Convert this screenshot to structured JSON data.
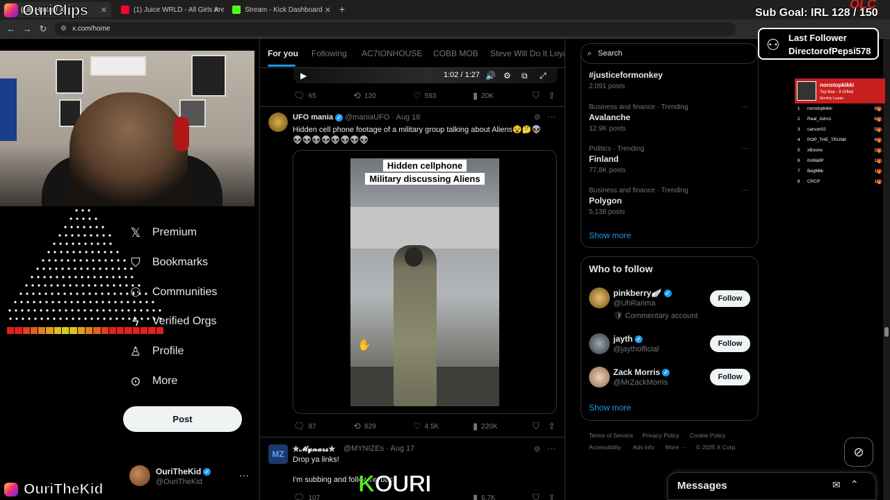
{
  "browser": {
    "tabs": [
      {
        "title": "(18) Home / X",
        "color": "#e0245e"
      },
      {
        "title": "(1) Juice WRLD - All Girls Are Th",
        "color": "#ff0033"
      },
      {
        "title": "Stream - Kick Dashboard",
        "color": "#53fc18"
      }
    ],
    "new_tab": "+",
    "url": "x.com/home"
  },
  "overlay": {
    "brand": "OuriClips",
    "sub_goal": "Sub Goal: IRL  128 / 150",
    "olc": "OLC",
    "last_follower_label": "Last Follower",
    "last_follower_name": "DirectorofPepsi578",
    "streamer": "OuriTheKid",
    "kick_logo": "K",
    "kick_text": "OURI",
    "leaderboard": {
      "top_name": "nonstopkikki",
      "top_sub": "Top Bae - 9 Gifted",
      "top_sub2": "Monthly Leader",
      "rows": [
        {
          "rank": "1",
          "user": "nonstopkikki",
          "count": "9"
        },
        {
          "rank": "2",
          "user": "Real_John1",
          "count": "6"
        },
        {
          "rank": "3",
          "user": "carson02",
          "count": "5"
        },
        {
          "rank": "4",
          "user": "POP_THE_TRUNK",
          "count": "4"
        },
        {
          "rank": "5",
          "user": "xBoone",
          "count": "2"
        },
        {
          "rank": "6",
          "user": "itsWaltP",
          "count": "1"
        },
        {
          "rank": "7",
          "user": "BegMilk",
          "count": "1"
        },
        {
          "rank": "8",
          "user": "CRCP",
          "count": "1"
        }
      ]
    }
  },
  "left_nav": {
    "items": [
      {
        "label": "Premium",
        "icon": "x-logo-icon",
        "glyph": "𝕏"
      },
      {
        "label": "Bookmarks",
        "icon": "bookmark-icon",
        "glyph": "🔖"
      },
      {
        "label": "Communities",
        "icon": "communities-icon",
        "glyph": "👥"
      },
      {
        "label": "Verified Orgs",
        "icon": "lightning-icon",
        "glyph": "⚡"
      },
      {
        "label": "Profile",
        "icon": "person-icon",
        "glyph": "👤"
      },
      {
        "label": "More",
        "icon": "more-circle-icon",
        "glyph": "⋯"
      }
    ],
    "post_label": "Post",
    "account": {
      "name": "OuriTheKid",
      "handle": "@OuriTheKid",
      "more": "···"
    }
  },
  "feed": {
    "tabs": [
      "For you",
      "Following",
      "AC7IONHOUSE",
      "COBB MOB",
      "Steve Will Do It Loyal"
    ],
    "active_tab": "For you",
    "video_time": "1:02 / 1:27",
    "tweet0_actions": {
      "replies": "65",
      "reposts": "120",
      "likes": "593",
      "views": "20K"
    },
    "tweet1": {
      "name": "UFO mania",
      "handle": "@maniaUFO · Aug 18",
      "text1": "Hidden cell phone footage of a military group talking about Aliens😵🤔👽",
      "text2": "👽👽👽👽👽👽👽👽",
      "caption1": "Hidden cellphone",
      "caption2": "Military discussing Aliens",
      "actions": {
        "replies": "87",
        "reposts": "829",
        "likes": "4.5K",
        "views": "220K"
      }
    },
    "tweet2": {
      "name": "✮𝓜𝔂𝓷𝓪𝓻𝓼✮",
      "handle": "@MYNIZEs · Aug 17",
      "text1": "Drop ya links!",
      "text2": "I'm subbing and following back",
      "actions": {
        "replies": "107",
        "reposts": "",
        "likes": "",
        "views": "6.7K"
      }
    }
  },
  "right": {
    "search_placeholder": "Search",
    "trends": [
      {
        "category": "",
        "name": "#justiceformonkey",
        "posts": "2,091 posts"
      },
      {
        "category": "Business and finance · Trending",
        "name": "Avalanche",
        "posts": "12.9K posts"
      },
      {
        "category": "Politics · Trending",
        "name": "Finland",
        "posts": "77.8K posts"
      },
      {
        "category": "Business and finance · Trending",
        "name": "Polygon",
        "posts": "5,138 posts"
      }
    ],
    "show_more": "Show more",
    "who_to_follow_title": "Who to follow",
    "who_to_follow": [
      {
        "name": "pinkberry🪽",
        "handle": "@UhRanma",
        "note": "🛡 Commentary account",
        "button": "Follow"
      },
      {
        "name": "jayth",
        "handle": "@jaythofficial",
        "note": "",
        "button": "Follow"
      },
      {
        "name": "Zack Morris",
        "handle": "@MrZackMorris",
        "note": "",
        "button": "Follow"
      }
    ],
    "show_more_2": "Show more",
    "footer": [
      "Terms of Service",
      "Privacy Policy",
      "Cookie Policy",
      "Accessibility",
      "Ads info",
      "More ···",
      "© 2025 X Corp."
    ],
    "messages_label": "Messages"
  },
  "colors": {
    "accent": "#1d9bf0",
    "background": "#000000",
    "kick_green": "#53fc18",
    "leaderboard_red": "#c81e1e"
  }
}
